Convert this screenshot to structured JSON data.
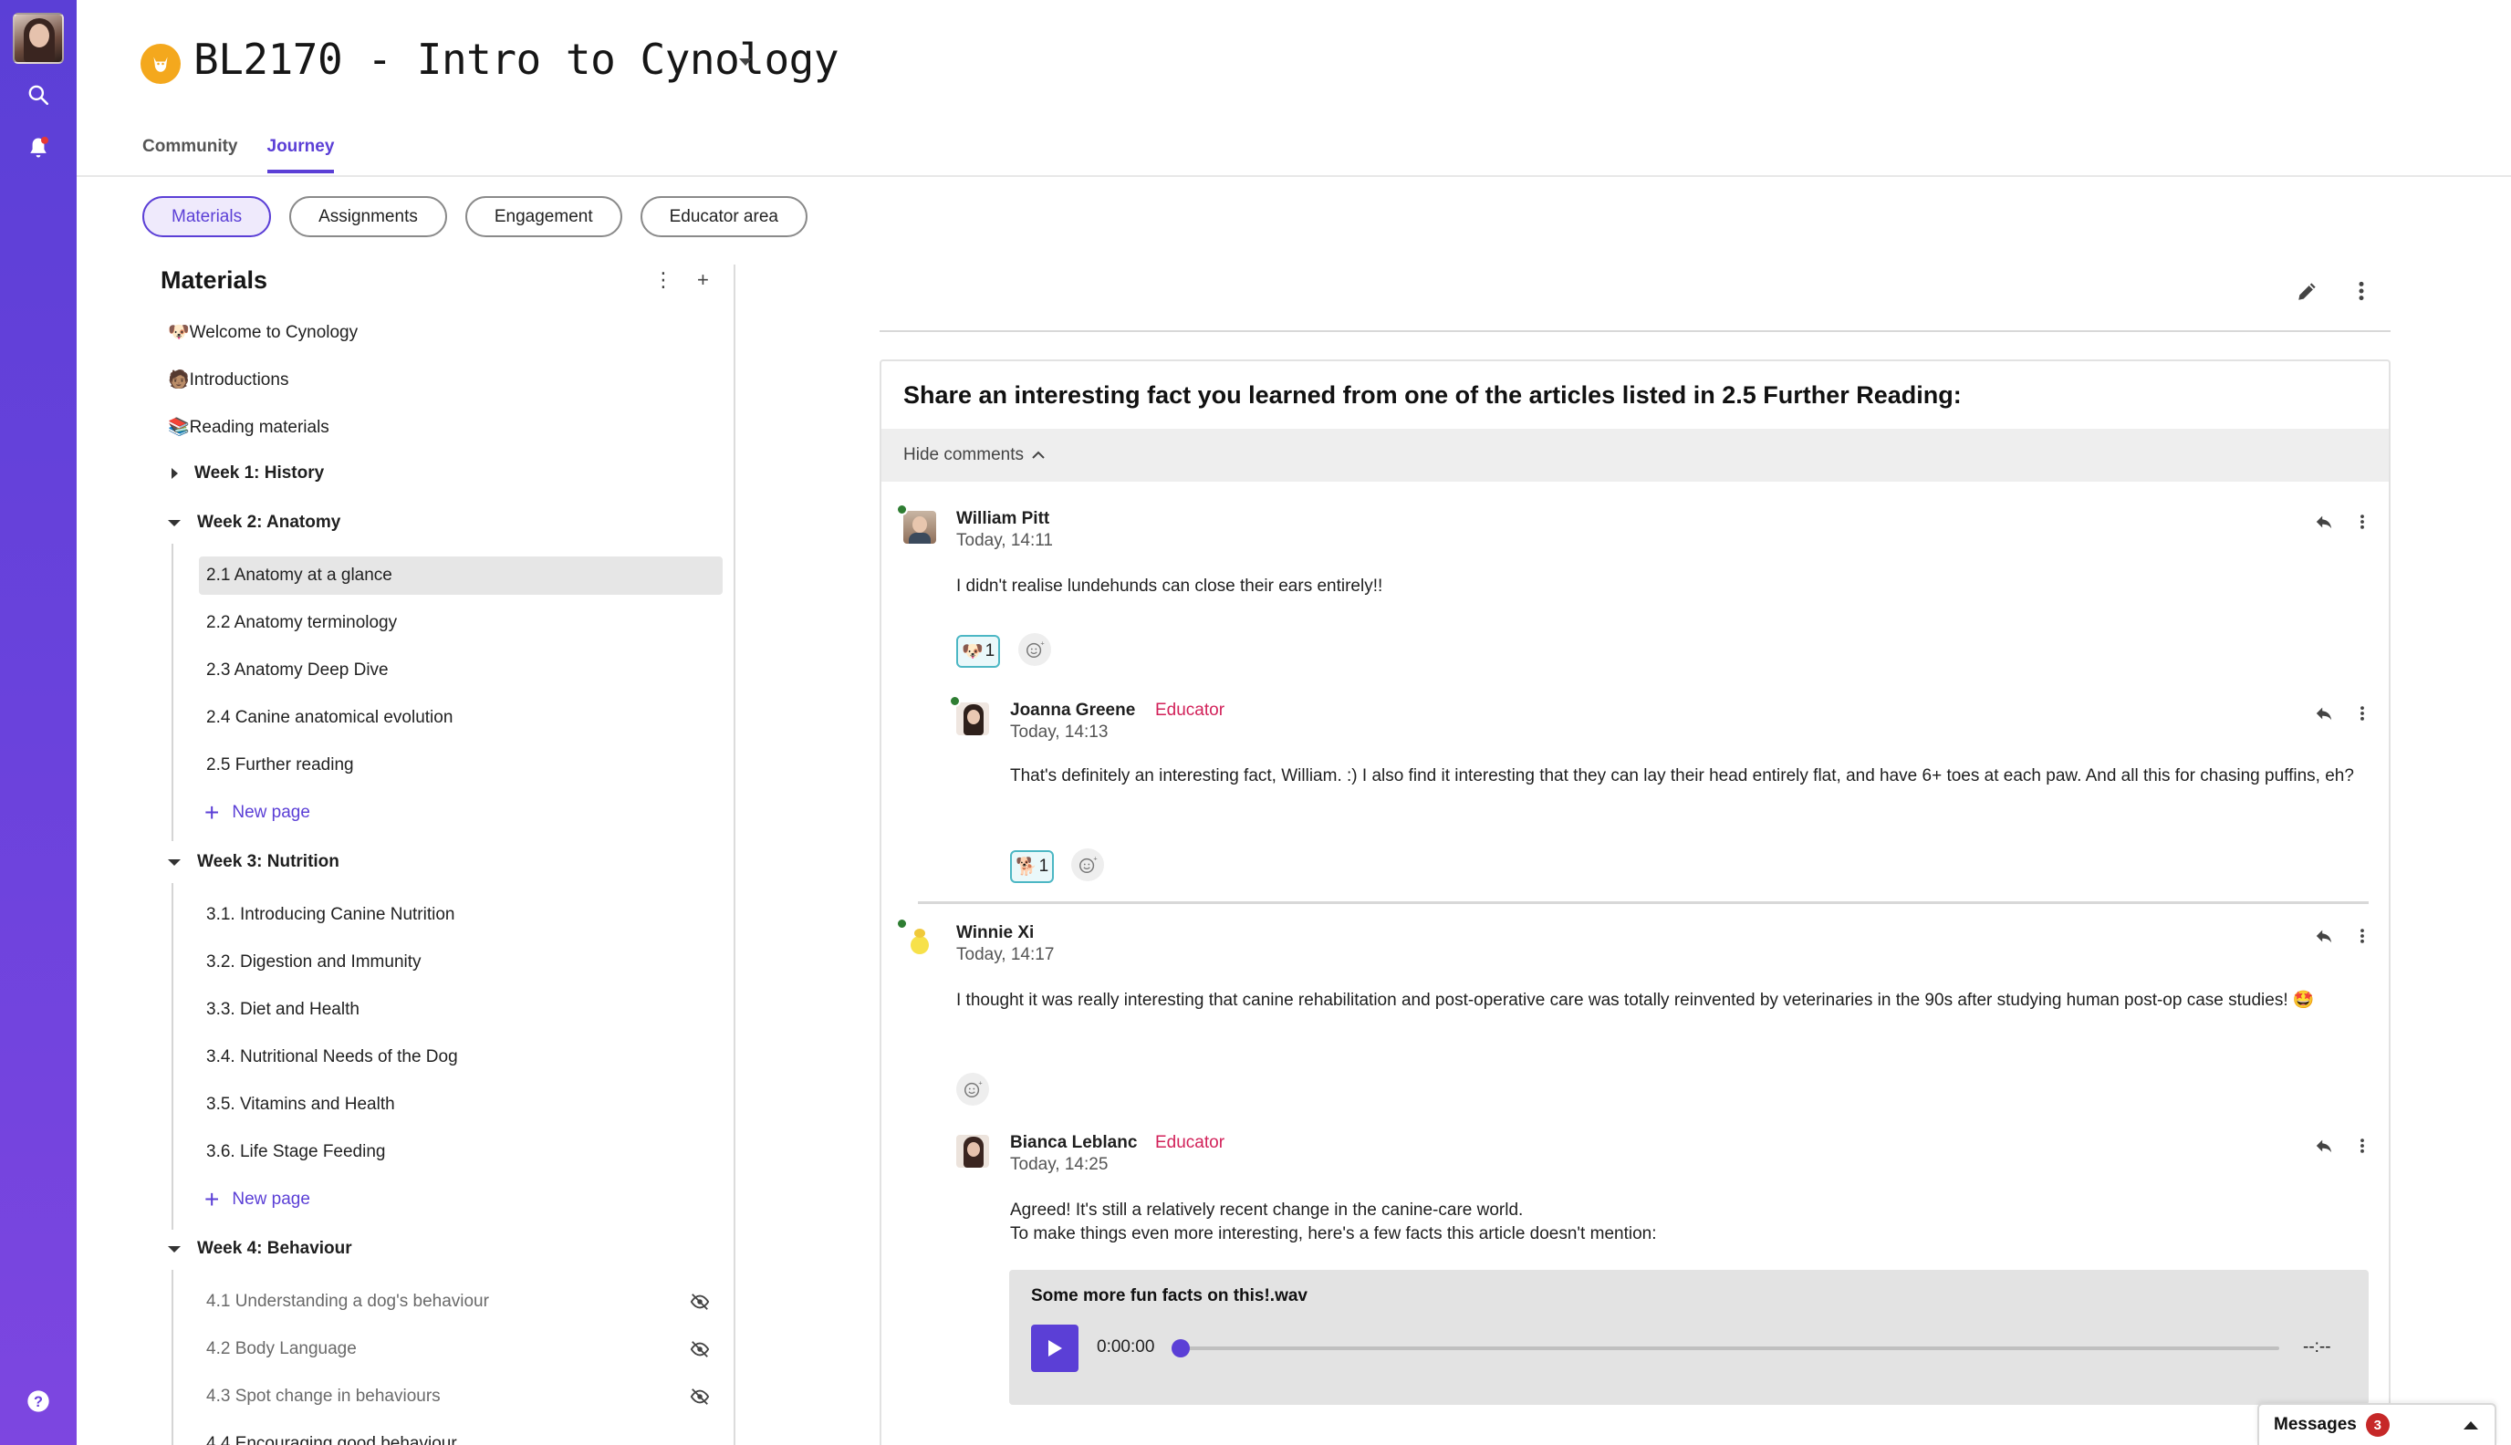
{
  "course": {
    "title": "BL2170 - Intro to Cynology"
  },
  "tabs": [
    {
      "label": "Community"
    },
    {
      "label": "Journey"
    }
  ],
  "pills": [
    {
      "label": "Materials"
    },
    {
      "label": "Assignments"
    },
    {
      "label": "Engagement"
    },
    {
      "label": "Educator area"
    }
  ],
  "sidebar": {
    "heading": "Materials",
    "top_items": [
      {
        "label": "🐶Welcome to Cynology"
      },
      {
        "label": "🧑🏽Introductions"
      },
      {
        "label": "📚Reading materials"
      }
    ],
    "week1": {
      "label": "Week 1: History"
    },
    "week2": {
      "label": "Week 2: Anatomy",
      "pages": [
        {
          "label": "2.1 Anatomy at a glance"
        },
        {
          "label": "2.2 Anatomy terminology"
        },
        {
          "label": "2.3 Anatomy Deep Dive"
        },
        {
          "label": "2.4 Canine anatomical evolution"
        },
        {
          "label": "2.5 Further reading"
        }
      ]
    },
    "week3": {
      "label": "Week 3: Nutrition",
      "pages": [
        {
          "label": "3.1. Introducing Canine Nutrition"
        },
        {
          "label": "3.2. Digestion and Immunity"
        },
        {
          "label": "3.3. Diet and Health"
        },
        {
          "label": "3.4. Nutritional Needs of the Dog"
        },
        {
          "label": "3.5. Vitamins and Health"
        },
        {
          "label": "3.6. Life Stage Feeding"
        }
      ]
    },
    "week4": {
      "label": "Week 4: Behaviour",
      "pages": [
        {
          "label": "4.1 Understanding a dog's behaviour"
        },
        {
          "label": "4.2 Body Language"
        },
        {
          "label": "4.3 Spot change in behaviours"
        },
        {
          "label": "4.4 Encouraging good behaviour"
        }
      ]
    },
    "new_page_label": "New page"
  },
  "post": {
    "title": "Share an interesting fact you learned from one of the articles listed in 2.5 Further Reading:",
    "hide_comments_label": "Hide comments"
  },
  "comments": [
    {
      "name": "William Pitt",
      "time": "Today, 14:11",
      "body": "I didn't realise lundehunds can close their ears entirely!!",
      "reaction_emoji": "🐶",
      "reaction_count": "1"
    },
    {
      "name": "Joanna Greene",
      "role": "Educator",
      "time": "Today, 14:13",
      "body": "That's definitely an interesting fact, William. :) I also find it interesting that they can lay their head entirely flat, and have 6+ toes at each paw. And all this for chasing puffins, eh?",
      "reaction_emoji": "🐕",
      "reaction_count": "1"
    },
    {
      "name": "Winnie Xi",
      "time": "Today, 14:17",
      "body": "I thought it was really interesting that canine rehabilitation and post-operative care was totally reinvented by veterinaries in the 90s after studying human post-op case studies! 🤩"
    },
    {
      "name": "Bianca Leblanc",
      "role": "Educator",
      "time": "Today, 14:25",
      "body_line1": "Agreed! It's still a relatively recent change in the canine-care world.",
      "body_line2": "To make things even more interesting, here's a few facts this article doesn't mention:"
    }
  ],
  "audio": {
    "title": "Some more fun facts on this!.wav",
    "current_time": "0:00:00",
    "duration": "--:--",
    "progress": 0
  },
  "messages": {
    "label": "Messages",
    "count": "3"
  },
  "colors": {
    "accent": "#5b3fd6",
    "educator": "#d2225a",
    "online": "#2e7d32",
    "badge": "#c62828"
  }
}
